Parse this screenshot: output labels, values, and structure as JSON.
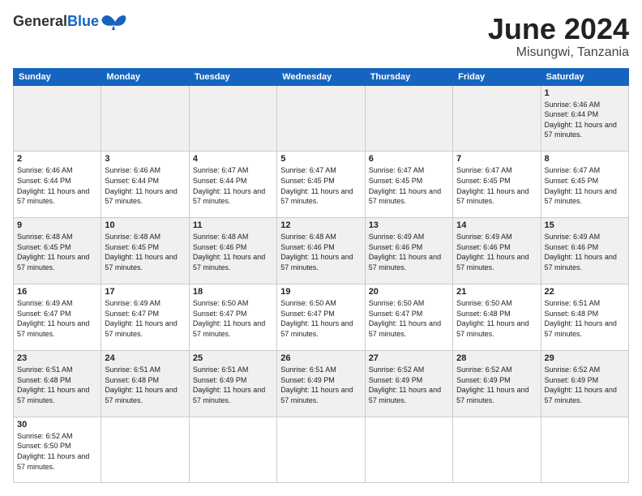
{
  "header": {
    "logo_general": "General",
    "logo_blue": "Blue",
    "month_title": "June 2024",
    "location": "Misungwi, Tanzania"
  },
  "weekdays": [
    "Sunday",
    "Monday",
    "Tuesday",
    "Wednesday",
    "Thursday",
    "Friday",
    "Saturday"
  ],
  "weeks": [
    [
      {
        "day": "",
        "sunrise": "",
        "sunset": "",
        "daylight": ""
      },
      {
        "day": "",
        "sunrise": "",
        "sunset": "",
        "daylight": ""
      },
      {
        "day": "",
        "sunrise": "",
        "sunset": "",
        "daylight": ""
      },
      {
        "day": "",
        "sunrise": "",
        "sunset": "",
        "daylight": ""
      },
      {
        "day": "",
        "sunrise": "",
        "sunset": "",
        "daylight": ""
      },
      {
        "day": "",
        "sunrise": "",
        "sunset": "",
        "daylight": ""
      },
      {
        "day": "1",
        "sunrise": "Sunrise: 6:46 AM",
        "sunset": "Sunset: 6:44 PM",
        "daylight": "Daylight: 11 hours and 57 minutes."
      }
    ],
    [
      {
        "day": "2",
        "sunrise": "Sunrise: 6:46 AM",
        "sunset": "Sunset: 6:44 PM",
        "daylight": "Daylight: 11 hours and 57 minutes."
      },
      {
        "day": "3",
        "sunrise": "Sunrise: 6:46 AM",
        "sunset": "Sunset: 6:44 PM",
        "daylight": "Daylight: 11 hours and 57 minutes."
      },
      {
        "day": "4",
        "sunrise": "Sunrise: 6:47 AM",
        "sunset": "Sunset: 6:44 PM",
        "daylight": "Daylight: 11 hours and 57 minutes."
      },
      {
        "day": "5",
        "sunrise": "Sunrise: 6:47 AM",
        "sunset": "Sunset: 6:45 PM",
        "daylight": "Daylight: 11 hours and 57 minutes."
      },
      {
        "day": "6",
        "sunrise": "Sunrise: 6:47 AM",
        "sunset": "Sunset: 6:45 PM",
        "daylight": "Daylight: 11 hours and 57 minutes."
      },
      {
        "day": "7",
        "sunrise": "Sunrise: 6:47 AM",
        "sunset": "Sunset: 6:45 PM",
        "daylight": "Daylight: 11 hours and 57 minutes."
      },
      {
        "day": "8",
        "sunrise": "Sunrise: 6:47 AM",
        "sunset": "Sunset: 6:45 PM",
        "daylight": "Daylight: 11 hours and 57 minutes."
      }
    ],
    [
      {
        "day": "9",
        "sunrise": "Sunrise: 6:48 AM",
        "sunset": "Sunset: 6:45 PM",
        "daylight": "Daylight: 11 hours and 57 minutes."
      },
      {
        "day": "10",
        "sunrise": "Sunrise: 6:48 AM",
        "sunset": "Sunset: 6:45 PM",
        "daylight": "Daylight: 11 hours and 57 minutes."
      },
      {
        "day": "11",
        "sunrise": "Sunrise: 6:48 AM",
        "sunset": "Sunset: 6:46 PM",
        "daylight": "Daylight: 11 hours and 57 minutes."
      },
      {
        "day": "12",
        "sunrise": "Sunrise: 6:48 AM",
        "sunset": "Sunset: 6:46 PM",
        "daylight": "Daylight: 11 hours and 57 minutes."
      },
      {
        "day": "13",
        "sunrise": "Sunrise: 6:49 AM",
        "sunset": "Sunset: 6:46 PM",
        "daylight": "Daylight: 11 hours and 57 minutes."
      },
      {
        "day": "14",
        "sunrise": "Sunrise: 6:49 AM",
        "sunset": "Sunset: 6:46 PM",
        "daylight": "Daylight: 11 hours and 57 minutes."
      },
      {
        "day": "15",
        "sunrise": "Sunrise: 6:49 AM",
        "sunset": "Sunset: 6:46 PM",
        "daylight": "Daylight: 11 hours and 57 minutes."
      }
    ],
    [
      {
        "day": "16",
        "sunrise": "Sunrise: 6:49 AM",
        "sunset": "Sunset: 6:47 PM",
        "daylight": "Daylight: 11 hours and 57 minutes."
      },
      {
        "day": "17",
        "sunrise": "Sunrise: 6:49 AM",
        "sunset": "Sunset: 6:47 PM",
        "daylight": "Daylight: 11 hours and 57 minutes."
      },
      {
        "day": "18",
        "sunrise": "Sunrise: 6:50 AM",
        "sunset": "Sunset: 6:47 PM",
        "daylight": "Daylight: 11 hours and 57 minutes."
      },
      {
        "day": "19",
        "sunrise": "Sunrise: 6:50 AM",
        "sunset": "Sunset: 6:47 PM",
        "daylight": "Daylight: 11 hours and 57 minutes."
      },
      {
        "day": "20",
        "sunrise": "Sunrise: 6:50 AM",
        "sunset": "Sunset: 6:47 PM",
        "daylight": "Daylight: 11 hours and 57 minutes."
      },
      {
        "day": "21",
        "sunrise": "Sunrise: 6:50 AM",
        "sunset": "Sunset: 6:48 PM",
        "daylight": "Daylight: 11 hours and 57 minutes."
      },
      {
        "day": "22",
        "sunrise": "Sunrise: 6:51 AM",
        "sunset": "Sunset: 6:48 PM",
        "daylight": "Daylight: 11 hours and 57 minutes."
      }
    ],
    [
      {
        "day": "23",
        "sunrise": "Sunrise: 6:51 AM",
        "sunset": "Sunset: 6:48 PM",
        "daylight": "Daylight: 11 hours and 57 minutes."
      },
      {
        "day": "24",
        "sunrise": "Sunrise: 6:51 AM",
        "sunset": "Sunset: 6:48 PM",
        "daylight": "Daylight: 11 hours and 57 minutes."
      },
      {
        "day": "25",
        "sunrise": "Sunrise: 6:51 AM",
        "sunset": "Sunset: 6:49 PM",
        "daylight": "Daylight: 11 hours and 57 minutes."
      },
      {
        "day": "26",
        "sunrise": "Sunrise: 6:51 AM",
        "sunset": "Sunset: 6:49 PM",
        "daylight": "Daylight: 11 hours and 57 minutes."
      },
      {
        "day": "27",
        "sunrise": "Sunrise: 6:52 AM",
        "sunset": "Sunset: 6:49 PM",
        "daylight": "Daylight: 11 hours and 57 minutes."
      },
      {
        "day": "28",
        "sunrise": "Sunrise: 6:52 AM",
        "sunset": "Sunset: 6:49 PM",
        "daylight": "Daylight: 11 hours and 57 minutes."
      },
      {
        "day": "29",
        "sunrise": "Sunrise: 6:52 AM",
        "sunset": "Sunset: 6:49 PM",
        "daylight": "Daylight: 11 hours and 57 minutes."
      }
    ],
    [
      {
        "day": "30",
        "sunrise": "Sunrise: 6:52 AM",
        "sunset": "Sunset: 6:50 PM",
        "daylight": "Daylight: 11 hours and 57 minutes."
      },
      {
        "day": "",
        "sunrise": "",
        "sunset": "",
        "daylight": ""
      },
      {
        "day": "",
        "sunrise": "",
        "sunset": "",
        "daylight": ""
      },
      {
        "day": "",
        "sunrise": "",
        "sunset": "",
        "daylight": ""
      },
      {
        "day": "",
        "sunrise": "",
        "sunset": "",
        "daylight": ""
      },
      {
        "day": "",
        "sunrise": "",
        "sunset": "",
        "daylight": ""
      },
      {
        "day": "",
        "sunrise": "",
        "sunset": "",
        "daylight": ""
      }
    ]
  ]
}
